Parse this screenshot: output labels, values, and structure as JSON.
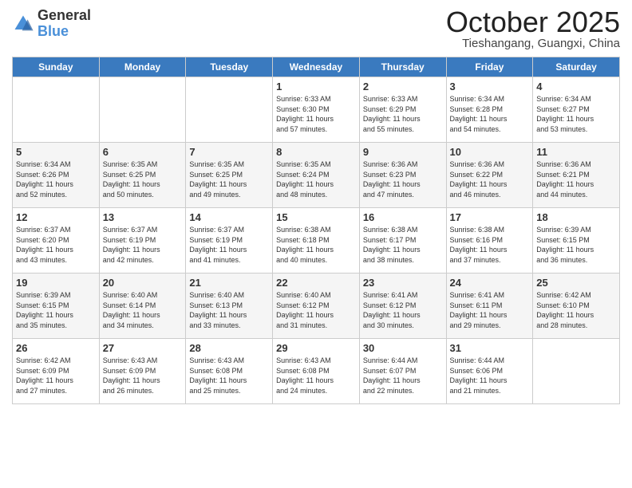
{
  "logo": {
    "general": "General",
    "blue": "Blue"
  },
  "header": {
    "month": "October 2025",
    "location": "Tieshangang, Guangxi, China"
  },
  "weekdays": [
    "Sunday",
    "Monday",
    "Tuesday",
    "Wednesday",
    "Thursday",
    "Friday",
    "Saturday"
  ],
  "weeks": [
    [
      {
        "day": "",
        "info": ""
      },
      {
        "day": "",
        "info": ""
      },
      {
        "day": "",
        "info": ""
      },
      {
        "day": "1",
        "info": "Sunrise: 6:33 AM\nSunset: 6:30 PM\nDaylight: 11 hours\nand 57 minutes."
      },
      {
        "day": "2",
        "info": "Sunrise: 6:33 AM\nSunset: 6:29 PM\nDaylight: 11 hours\nand 55 minutes."
      },
      {
        "day": "3",
        "info": "Sunrise: 6:34 AM\nSunset: 6:28 PM\nDaylight: 11 hours\nand 54 minutes."
      },
      {
        "day": "4",
        "info": "Sunrise: 6:34 AM\nSunset: 6:27 PM\nDaylight: 11 hours\nand 53 minutes."
      }
    ],
    [
      {
        "day": "5",
        "info": "Sunrise: 6:34 AM\nSunset: 6:26 PM\nDaylight: 11 hours\nand 52 minutes."
      },
      {
        "day": "6",
        "info": "Sunrise: 6:35 AM\nSunset: 6:25 PM\nDaylight: 11 hours\nand 50 minutes."
      },
      {
        "day": "7",
        "info": "Sunrise: 6:35 AM\nSunset: 6:25 PM\nDaylight: 11 hours\nand 49 minutes."
      },
      {
        "day": "8",
        "info": "Sunrise: 6:35 AM\nSunset: 6:24 PM\nDaylight: 11 hours\nand 48 minutes."
      },
      {
        "day": "9",
        "info": "Sunrise: 6:36 AM\nSunset: 6:23 PM\nDaylight: 11 hours\nand 47 minutes."
      },
      {
        "day": "10",
        "info": "Sunrise: 6:36 AM\nSunset: 6:22 PM\nDaylight: 11 hours\nand 46 minutes."
      },
      {
        "day": "11",
        "info": "Sunrise: 6:36 AM\nSunset: 6:21 PM\nDaylight: 11 hours\nand 44 minutes."
      }
    ],
    [
      {
        "day": "12",
        "info": "Sunrise: 6:37 AM\nSunset: 6:20 PM\nDaylight: 11 hours\nand 43 minutes."
      },
      {
        "day": "13",
        "info": "Sunrise: 6:37 AM\nSunset: 6:19 PM\nDaylight: 11 hours\nand 42 minutes."
      },
      {
        "day": "14",
        "info": "Sunrise: 6:37 AM\nSunset: 6:19 PM\nDaylight: 11 hours\nand 41 minutes."
      },
      {
        "day": "15",
        "info": "Sunrise: 6:38 AM\nSunset: 6:18 PM\nDaylight: 11 hours\nand 40 minutes."
      },
      {
        "day": "16",
        "info": "Sunrise: 6:38 AM\nSunset: 6:17 PM\nDaylight: 11 hours\nand 38 minutes."
      },
      {
        "day": "17",
        "info": "Sunrise: 6:38 AM\nSunset: 6:16 PM\nDaylight: 11 hours\nand 37 minutes."
      },
      {
        "day": "18",
        "info": "Sunrise: 6:39 AM\nSunset: 6:15 PM\nDaylight: 11 hours\nand 36 minutes."
      }
    ],
    [
      {
        "day": "19",
        "info": "Sunrise: 6:39 AM\nSunset: 6:15 PM\nDaylight: 11 hours\nand 35 minutes."
      },
      {
        "day": "20",
        "info": "Sunrise: 6:40 AM\nSunset: 6:14 PM\nDaylight: 11 hours\nand 34 minutes."
      },
      {
        "day": "21",
        "info": "Sunrise: 6:40 AM\nSunset: 6:13 PM\nDaylight: 11 hours\nand 33 minutes."
      },
      {
        "day": "22",
        "info": "Sunrise: 6:40 AM\nSunset: 6:12 PM\nDaylight: 11 hours\nand 31 minutes."
      },
      {
        "day": "23",
        "info": "Sunrise: 6:41 AM\nSunset: 6:12 PM\nDaylight: 11 hours\nand 30 minutes."
      },
      {
        "day": "24",
        "info": "Sunrise: 6:41 AM\nSunset: 6:11 PM\nDaylight: 11 hours\nand 29 minutes."
      },
      {
        "day": "25",
        "info": "Sunrise: 6:42 AM\nSunset: 6:10 PM\nDaylight: 11 hours\nand 28 minutes."
      }
    ],
    [
      {
        "day": "26",
        "info": "Sunrise: 6:42 AM\nSunset: 6:09 PM\nDaylight: 11 hours\nand 27 minutes."
      },
      {
        "day": "27",
        "info": "Sunrise: 6:43 AM\nSunset: 6:09 PM\nDaylight: 11 hours\nand 26 minutes."
      },
      {
        "day": "28",
        "info": "Sunrise: 6:43 AM\nSunset: 6:08 PM\nDaylight: 11 hours\nand 25 minutes."
      },
      {
        "day": "29",
        "info": "Sunrise: 6:43 AM\nSunset: 6:08 PM\nDaylight: 11 hours\nand 24 minutes."
      },
      {
        "day": "30",
        "info": "Sunrise: 6:44 AM\nSunset: 6:07 PM\nDaylight: 11 hours\nand 22 minutes."
      },
      {
        "day": "31",
        "info": "Sunrise: 6:44 AM\nSunset: 6:06 PM\nDaylight: 11 hours\nand 21 minutes."
      },
      {
        "day": "",
        "info": ""
      }
    ]
  ]
}
